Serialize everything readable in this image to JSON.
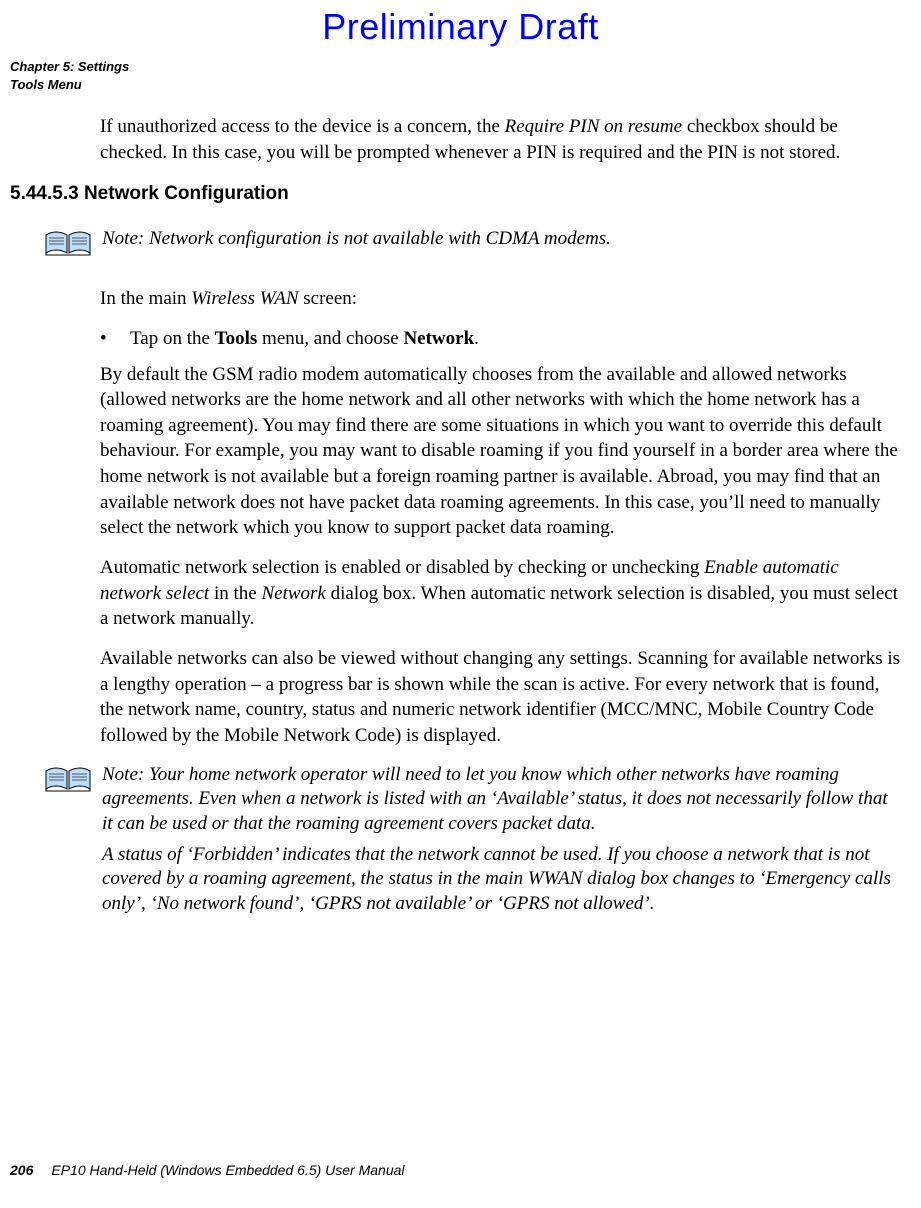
{
  "watermark": "Preliminary Draft",
  "header": {
    "line1": "Chapter 5: Settings",
    "line2": "Tools Menu"
  },
  "intro_para": {
    "pre1": "If unauthorized access to the device is a concern, the ",
    "em1": "Require PIN on resume",
    "post1": " checkbox should be checked. In this case, you will be prompted whenever a PIN is required and the PIN is not stored."
  },
  "section_heading": "5.44.5.3 Network Configuration",
  "note1": {
    "label": "Note:",
    "text": " Network configuration is not available with CDMA modems."
  },
  "para2": {
    "pre1": "In the main ",
    "em1": "Wireless WAN",
    "post1": " screen:"
  },
  "bullet1": {
    "mark": "•",
    "pre": "Tap on the ",
    "b1": "Tools",
    "mid": " menu, and choose ",
    "b2": "Network",
    "post": "."
  },
  "para3": "By default the GSM radio modem automatically chooses from the available and allowed networks (allowed networks are the home network and all other networks with which the home network has a roaming agreement). You may find there are some situations in which you want to override this default behaviour. For example, you may want to disable roaming if you find yourself in a border area where the home network is not available but a foreign roaming partner is available. Abroad, you may find that an available network does not have packet data roaming agreements. In this case, you’ll need to manually select the network which you know to support packet data roaming.",
  "para4": {
    "pre1": "Automatic network selection is enabled or disabled by checking or unchecking ",
    "em1": "Enable auto­matic network select",
    "mid1": " in the ",
    "em2": "Network",
    "post1": " dialog box. When automatic network selection is disabled, you must select a network manually."
  },
  "para5": "Available networks can also be viewed without changing any settings. Scanning for avail­able networks is a lengthy operation – a progress bar is shown while the scan is active. For every network that is found, the network name, country, status and numeric network identi­fier (MCC/MNC, Mobile Country Code followed by the Mobile Network Code) is displayed.",
  "note2": {
    "label": "Note:",
    "p1": " Your home network operator will need to let you know which other networks have roaming agreements. Even when a network is listed with an ‘Available’ status, it does not necessarily follow that it can be used or that the roaming agreement cov­ers packet data.",
    "p2": "A status of ‘Forbidden’ indicates that the network cannot be used. If you choose a network that is not covered by a roaming agreement, the status in the main WWAN dialog box changes to ‘Emergency calls only’, ‘No network found’, ‘GPRS not available’ or ‘GPRS not allowed’."
  },
  "footer": {
    "page": "206",
    "title": "EP10 Hand-Held (Windows Embedded 6.5) User Manual"
  }
}
